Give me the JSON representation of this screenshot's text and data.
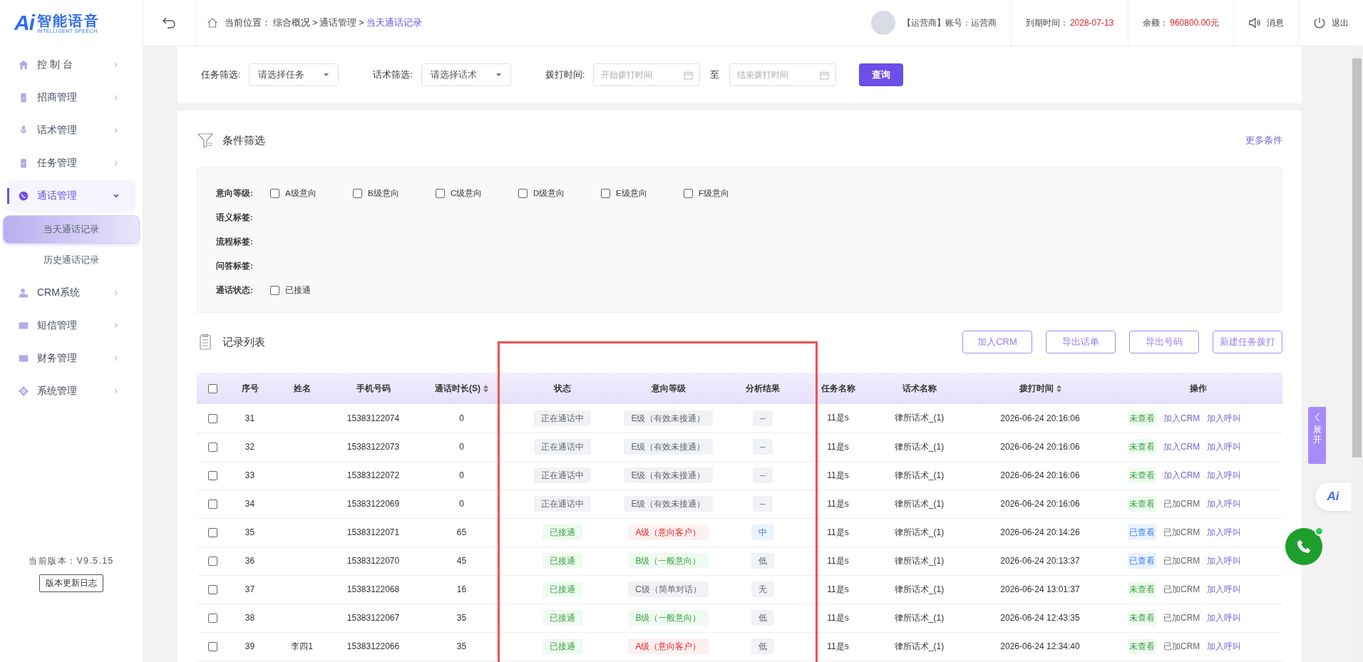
{
  "logo": {
    "mark": "Ai",
    "name": "智能语音",
    "tagline": "INTELLIGENT SPEECH"
  },
  "sidebar": {
    "items": [
      {
        "label": "控 制 台",
        "expanded": false
      },
      {
        "label": "招商管理",
        "expanded": false
      },
      {
        "label": "话术管理",
        "expanded": false
      },
      {
        "label": "任务管理",
        "expanded": false
      },
      {
        "label": "通话管理",
        "expanded": true,
        "children": [
          {
            "label": "当天通话记录",
            "selected": true
          },
          {
            "label": "历史通话记录",
            "selected": false
          }
        ]
      },
      {
        "label": "CRM系统",
        "expanded": false
      },
      {
        "label": "短信管理",
        "expanded": false
      },
      {
        "label": "财务管理",
        "expanded": false
      },
      {
        "label": "系统管理",
        "expanded": false
      }
    ],
    "version": "当前版本：V9.5.15",
    "changelog_button": "版本更新日志"
  },
  "header": {
    "breadcrumb_label": "当前位置：",
    "breadcrumb": [
      "综合概况",
      ">",
      "通话管理",
      ">",
      "当天通话记录"
    ],
    "account": "【运营商】账号：运营商",
    "expiry_label": "到期时间：",
    "expiry": "2028-07-13",
    "balance_label": "余额：",
    "balance": "960800.00元",
    "messages": "消息",
    "logout": "退出"
  },
  "query_bar": {
    "task_label": "任务筛选:",
    "task_placeholder": "请选择任务",
    "script_label": "话术筛选:",
    "script_placeholder": "请选择话术",
    "time_label": "拨打时间:",
    "start_placeholder": "开始拨打时间",
    "to": "至",
    "end_placeholder": "结束拨打时间",
    "search_button": "查询"
  },
  "conditions": {
    "title": "条件筛选",
    "more": "更多条件",
    "groups": [
      {
        "label": "意向等级:",
        "options": [
          {
            "label": "A级意向",
            "checked": false
          },
          {
            "label": "B级意向",
            "checked": false
          },
          {
            "label": "C级意向",
            "checked": false
          },
          {
            "label": "D级意向",
            "checked": false
          },
          {
            "label": "E级意向",
            "checked": false
          },
          {
            "label": "F级意向",
            "checked": false
          }
        ]
      },
      {
        "label": "语义标签:"
      },
      {
        "label": "流程标签:"
      },
      {
        "label": "问答标签:"
      },
      {
        "label": "通话状态:",
        "options": [
          {
            "label": "已接通",
            "checked": false
          }
        ]
      }
    ]
  },
  "records": {
    "title": "记录列表",
    "buttons": [
      "加入CRM",
      "导出话单",
      "导出号码",
      "新建任务拨打"
    ],
    "all_selected": false,
    "columns": [
      {
        "label": "序号",
        "sortable": false
      },
      {
        "label": "姓名",
        "sortable": false
      },
      {
        "label": "手机号码",
        "sortable": false
      },
      {
        "label": "通话时长(S)",
        "sortable": true
      },
      {
        "label": "状态",
        "sortable": false
      },
      {
        "label": "意向等级",
        "sortable": false
      },
      {
        "label": "分析结果",
        "sortable": false
      },
      {
        "label": "任务名称",
        "sortable": false
      },
      {
        "label": "话术名称",
        "sortable": false
      },
      {
        "label": "拨打时间",
        "sortable": true
      },
      {
        "label": "操作",
        "sortable": false
      }
    ],
    "rows": [
      {
        "selected": false,
        "seq": "31",
        "phone": "15383122074",
        "duration": "0",
        "status": {
          "text": "正在通话中",
          "color": "#f0f2f5"
        },
        "grade": {
          "text": "E级（有效未接通）",
          "color": "#f0f2f5"
        },
        "analysis": {
          "text": "--",
          "color": "#f0f2f5"
        },
        "task": "11是s",
        "script": "律所话术_(1)",
        "time": "2026-06-24 20:16:06",
        "view": {
          "text": "未查看",
          "viewed": false
        },
        "crm": {
          "text": "加入CRM",
          "added": false
        },
        "call": "加入呼叫"
      },
      {
        "selected": false,
        "seq": "32",
        "phone": "15383122073",
        "duration": "0",
        "status": {
          "text": "正在通话中",
          "color": "#f0f2f5"
        },
        "grade": {
          "text": "E级（有效未接通）",
          "color": "#f0f2f5"
        },
        "analysis": {
          "text": "--",
          "color": "#f0f2f5"
        },
        "task": "11是s",
        "script": "律所话术_(1)",
        "time": "2026-06-24 20:16:06",
        "view": {
          "text": "未查看",
          "viewed": false
        },
        "crm": {
          "text": "加入CRM",
          "added": false
        },
        "call": "加入呼叫"
      },
      {
        "selected": false,
        "seq": "33",
        "phone": "15383122072",
        "duration": "0",
        "status": {
          "text": "正在通话中",
          "color": "#f0f2f5"
        },
        "grade": {
          "text": "E级（有效未接通）",
          "color": "#f0f2f5"
        },
        "analysis": {
          "text": "--",
          "color": "#f0f2f5"
        },
        "task": "11是s",
        "script": "律所话术_(1)",
        "time": "2026-06-24 20:16:06",
        "view": {
          "text": "未查看",
          "viewed": false
        },
        "crm": {
          "text": "加入CRM",
          "added": false
        },
        "call": "加入呼叫"
      },
      {
        "selected": false,
        "seq": "34",
        "phone": "15383122069",
        "duration": "0",
        "status": {
          "text": "正在通话中",
          "color": "#f0f2f5"
        },
        "grade": {
          "text": "E级（有效未接通）",
          "color": "#f0f2f5"
        },
        "analysis": {
          "text": "--",
          "color": "#f0f2f5"
        },
        "task": "11是s",
        "script": "律所话术_(1)",
        "time": "2026-06-24 20:16:06",
        "view": {
          "text": "未查看",
          "viewed": false
        },
        "crm": {
          "text": "已加CRM",
          "added": true
        },
        "call": "加入呼叫"
      },
      {
        "selected": false,
        "seq": "35",
        "phone": "15383122071",
        "duration": "65",
        "status": {
          "text": "已接通",
          "color": "#effbf0"
        },
        "grade": {
          "text": "A级（意向客户）",
          "color": "#fef0f0"
        },
        "analysis": {
          "text": "中",
          "color": "#ecf3ff"
        },
        "task": "11是s",
        "script": "律所话术_(1)",
        "time": "2026-06-24 20:14:26",
        "view": {
          "text": "已查看",
          "viewed": true
        },
        "crm": {
          "text": "已加CRM",
          "added": true
        },
        "call": "加入呼叫"
      },
      {
        "selected": false,
        "seq": "36",
        "phone": "15383122070",
        "duration": "45",
        "status": {
          "text": "已接通",
          "color": "#effbf0"
        },
        "grade": {
          "text": "B级（一般意向）",
          "color": "#effbf0"
        },
        "analysis": {
          "text": "低",
          "color": "#f0f2f5"
        },
        "task": "11是s",
        "script": "律所话术_(1)",
        "time": "2026-06-24 20:13:37",
        "view": {
          "text": "已查看",
          "viewed": true
        },
        "crm": {
          "text": "已加CRM",
          "added": true
        },
        "call": "加入呼叫"
      },
      {
        "selected": false,
        "seq": "37",
        "phone": "15383122068",
        "duration": "16",
        "status": {
          "text": "已接通",
          "color": "#effbf0"
        },
        "grade": {
          "text": "C级（简单对话）",
          "color": "#f0f2f5"
        },
        "analysis": {
          "text": "无",
          "color": "#f0f2f5"
        },
        "task": "11是s",
        "script": "律所话术_(1)",
        "time": "2026-06-24 13:01:37",
        "view": {
          "text": "未查看",
          "viewed": false
        },
        "crm": {
          "text": "已加CRM",
          "added": true
        },
        "call": "加入呼叫"
      },
      {
        "selected": false,
        "seq": "38",
        "phone": "15383122067",
        "duration": "35",
        "status": {
          "text": "已接通",
          "color": "#effbf0"
        },
        "grade": {
          "text": "B级（一般意向）",
          "color": "#effbf0"
        },
        "analysis": {
          "text": "低",
          "color": "#f0f2f5"
        },
        "task": "11是s",
        "script": "律所话术_(1)",
        "time": "2026-06-24 12:43:35",
        "view": {
          "text": "未查看",
          "viewed": false
        },
        "crm": {
          "text": "已加CRM",
          "added": true
        },
        "call": "加入呼叫"
      },
      {
        "selected": false,
        "seq": "39",
        "name": "李四1",
        "phone": "15383122066",
        "duration": "35",
        "status": {
          "text": "已接通",
          "color": "#effbf0"
        },
        "grade": {
          "text": "A级（意向客户）",
          "color": "#fef0f0"
        },
        "analysis": {
          "text": "低",
          "color": "#f0f2f5"
        },
        "task": "11是s",
        "script": "律所话术_(1)",
        "time": "2026-06-24 12:34:40",
        "view": {
          "text": "未查看",
          "viewed": false
        },
        "crm": {
          "text": "已加CRM",
          "added": true
        },
        "call": "加入呼叫"
      }
    ]
  },
  "expand_tab": "展开",
  "ai_button": "Ai"
}
